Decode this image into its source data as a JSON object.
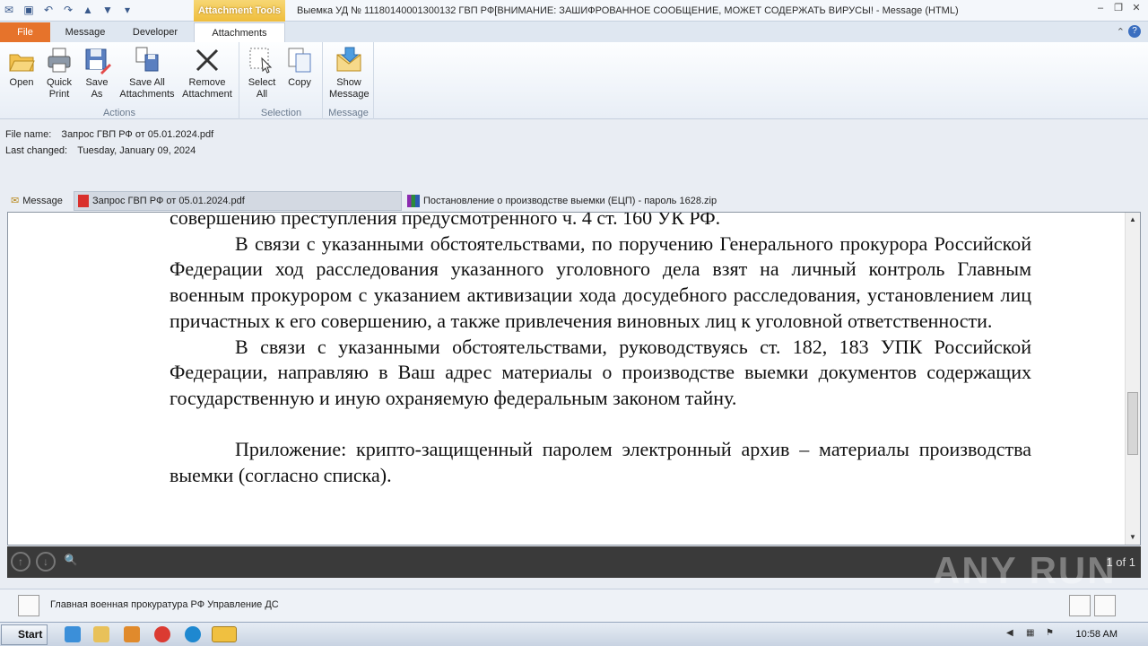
{
  "window": {
    "tools_tab": "Attachment Tools",
    "title": "Выемка УД № 11180140001300132 ГВП РФ[ВНИМАНИЕ: ЗАШИФРОВАННОЕ СООБЩЕНИЕ, МОЖЕТ СОДЕРЖАТЬ ВИРУСЫ! - Message (HTML)"
  },
  "tabs": [
    "File",
    "Message",
    "Developer",
    "Attachments"
  ],
  "ribbon": {
    "groups": [
      {
        "label": "Actions",
        "buttons": [
          {
            "l1": "Open",
            "l2": "",
            "icon": "open-folder-icon"
          },
          {
            "l1": "Quick",
            "l2": "Print",
            "icon": "printer-icon"
          },
          {
            "l1": "Save",
            "l2": "As",
            "icon": "save-as-icon"
          },
          {
            "l1": "Save All",
            "l2": "Attachments",
            "icon": "save-all-icon"
          },
          {
            "l1": "Remove",
            "l2": "Attachment",
            "icon": "remove-x-icon"
          }
        ]
      },
      {
        "label": "Selection",
        "buttons": [
          {
            "l1": "Select",
            "l2": "All",
            "icon": "select-all-icon"
          },
          {
            "l1": "Copy",
            "l2": "",
            "icon": "copy-icon"
          }
        ]
      },
      {
        "label": "Message",
        "buttons": [
          {
            "l1": "Show",
            "l2": "Message",
            "icon": "envelope-icon"
          }
        ]
      }
    ]
  },
  "file_info": {
    "name_label": "File name:",
    "name_value": "Запрос ГВП РФ от 05.01.2024.pdf",
    "changed_label": "Last changed:",
    "changed_value": "Tuesday, January 09, 2024"
  },
  "attachments": {
    "message": "Message",
    "pdf": "Запрос ГВП РФ от 05.01.2024.pdf",
    "zip": "Постановление о производстве выемки (ЕЦП) - пароль 1628.zip"
  },
  "document": {
    "p0": "совершению преступления предусмотренного ч. 4 ст. 160 УК РФ.",
    "p1": "В связи с указанными обстоятельствами, по поручению Генерального прокурора Российской Федерации ход расследования указанного уголовного дела взят на личный контроль Главным военным прокурором с указанием активизации хода досудебного расследования, установлением лиц причастных к его совершению, а также привлечения виновных лиц к уголовной ответственности.",
    "p2": "В связи с указанными обстоятельствами, руководствуясь ст. 182, 183 УПК Российской Федерации, направляю в Ваш адрес материалы о производстве выемки документов содержащих государственную и иную охраняемую федеральным законом тайну.",
    "p3": "Приложение: крипто-защищенный паролем электронный архив – материалы производства выемки (согласно списка)."
  },
  "viewer": {
    "page": "1 of 1"
  },
  "watermark": "ANY RUN",
  "people": {
    "sender": "Главная военная прокуратура РФ Управление ДС"
  },
  "taskbar": {
    "start": "Start",
    "time": "10:58 AM"
  }
}
